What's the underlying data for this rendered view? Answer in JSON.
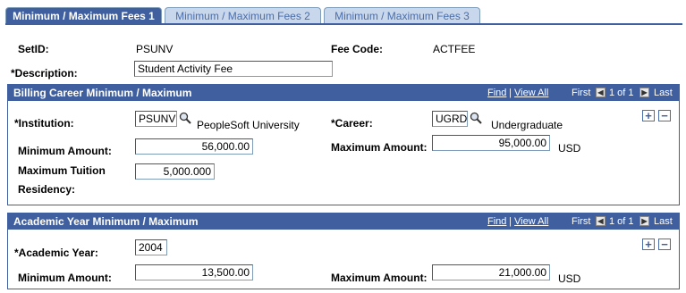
{
  "tabs": [
    {
      "label": "Minimum / Maximum Fees 1"
    },
    {
      "label": "Minimum / Maximum Fees 2"
    },
    {
      "label": "Minimum / Maximum Fees 3"
    }
  ],
  "header": {
    "setid_label": "SetID:",
    "setid_value": "PSUNV",
    "fee_code_label": "Fee Code:",
    "fee_code_value": "ACTFEE",
    "description_label": "*Description:",
    "description_value": "Student Activity Fee"
  },
  "billing": {
    "title": "Billing Career Minimum / Maximum",
    "nav": {
      "find": "Find",
      "sep": "|",
      "view_all": "View All",
      "first": "First",
      "count": "1 of 1",
      "last": "Last"
    },
    "institution_label": "*Institution:",
    "institution_value": "PSUNV",
    "institution_desc": "PeopleSoft University",
    "career_label": "*Career:",
    "career_value": "UGRD",
    "career_desc": "Undergraduate",
    "min_label": "Minimum Amount:",
    "min_value": "56,000.00",
    "max_label": "Maximum Amount:",
    "max_value": "95,000.00",
    "currency": "USD",
    "max_tuition_label": "Maximum Tuition",
    "max_tuition_value": "5,000.000",
    "residency_label": "Residency:"
  },
  "academic": {
    "title": "Academic Year Minimum / Maximum",
    "nav": {
      "find": "Find",
      "sep": "|",
      "view_all": "View All",
      "first": "First",
      "count": "1 of 1",
      "last": "Last"
    },
    "year_label": "*Academic Year:",
    "year_value": "2004",
    "min_label": "Minimum Amount:",
    "min_value": "13,500.00",
    "max_label": "Maximum Amount:",
    "max_value": "21,000.00",
    "currency": "USD"
  },
  "buttons": {
    "add": "+",
    "delete": "−",
    "prev": "◀",
    "next": "▶"
  },
  "colors": {
    "header_bg": "#3f5f9f",
    "tab_inactive_bg": "#c9d7ec"
  }
}
